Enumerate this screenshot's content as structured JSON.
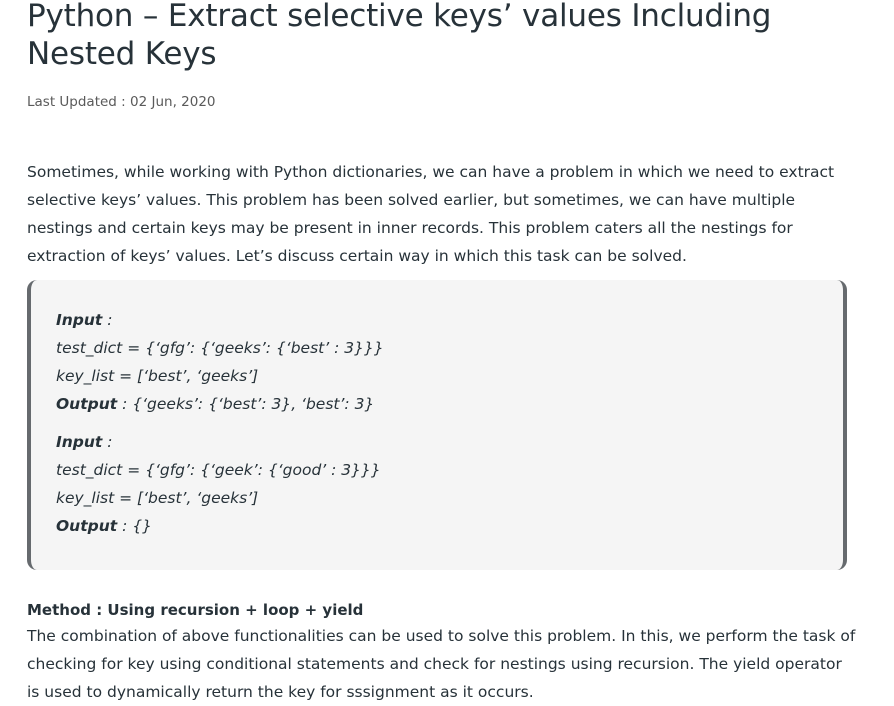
{
  "article": {
    "title": "Python – Extract selective keys’ values Including Nested Keys",
    "last_updated": "Last Updated : 02 Jun, 2020",
    "intro": "Sometimes, while working with Python dictionaries, we can have a problem in which we need to extract selective keys’ values. This problem has been solved earlier, but sometimes, we can have multiple nestings and certain keys may be present in inner records. This problem caters all the nestings for extraction of keys’ values. Let’s discuss certain way in which this task can be solved."
  },
  "examples": [
    {
      "input_label": "Input",
      "input_sep": " :",
      "test_dict": "test_dict = {‘gfg’: {‘geeks’: {‘best’ : 3}}}",
      "key_list": "key_list = [‘best’, ‘geeks’]",
      "output_label": "Output",
      "output_value": " : {‘geeks’: {‘best’: 3}, ‘best’: 3}"
    },
    {
      "input_label": "Input",
      "input_sep": " :",
      "test_dict": "test_dict = {‘gfg’: {‘geek’: {‘good’ : 3}}}",
      "key_list": "key_list = [‘best’, ‘geeks’]",
      "output_label": "Output",
      "output_value": " : {}"
    }
  ],
  "method": {
    "title": "Method : Using recursion + loop + yield",
    "text": "The combination of above functionalities can be used to solve this problem. In this, we perform the task of checking for key using conditional statements and check for nestings using recursion. The yield operator is used to dynamically return the key for sssignment as it occurs."
  }
}
